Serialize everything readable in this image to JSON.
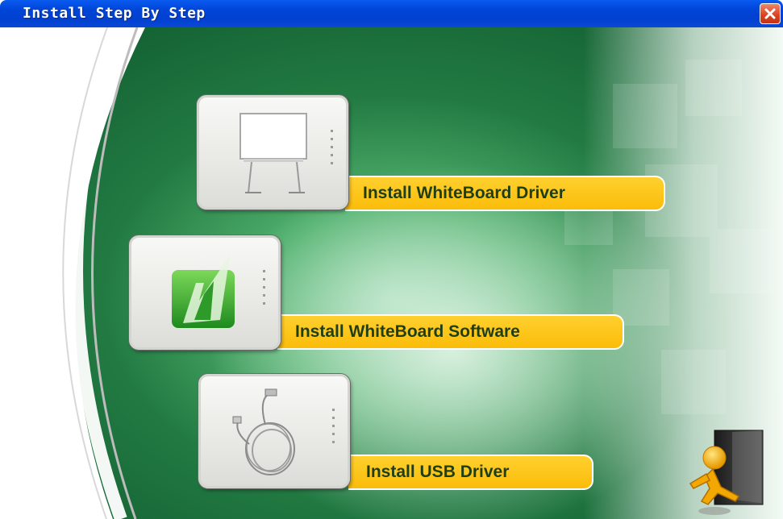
{
  "window": {
    "title": "Install Step By Step"
  },
  "title_bar": {
    "close_icon": "close-icon"
  },
  "buttons": [
    {
      "label": "Install WhiteBoard Driver",
      "icon": "whiteboard-icon"
    },
    {
      "label": "Install WhiteBoard Software",
      "icon": "software-logo-icon"
    },
    {
      "label": "Install USB Driver",
      "icon": "usb-cable-icon"
    }
  ],
  "exit": {
    "icon": "exit-running-man-icon"
  },
  "colors": {
    "title_bar": "#0045d8",
    "close_button": "#d9421f",
    "background_green": "#2f8a4e",
    "pill": "#fbbc0a",
    "pill_text": "#1e3f16"
  }
}
